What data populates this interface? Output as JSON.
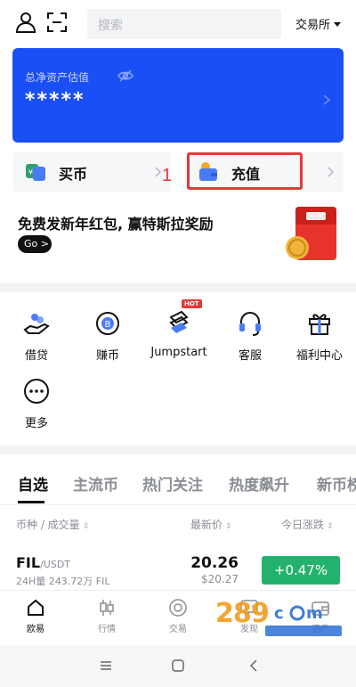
{
  "header": {
    "search_placeholder": "搜索",
    "exchange_label": "交易所"
  },
  "asset": {
    "label": "总净资产估值",
    "value": "*****"
  },
  "actions": {
    "buy_label": "买币",
    "deposit_label": "充值",
    "step_marker": "1"
  },
  "promo": {
    "text": "免费发新年红包, 赢特斯拉奖励",
    "button": "Go >"
  },
  "services": [
    {
      "label": "借贷",
      "icon": "loan-icon"
    },
    {
      "label": "赚币",
      "icon": "earn-coin-icon"
    },
    {
      "label": "Jumpstart",
      "icon": "jumpstart-icon",
      "badge": "HOT"
    },
    {
      "label": "客服",
      "icon": "headset-icon"
    },
    {
      "label": "福利中心",
      "icon": "gift-icon"
    },
    {
      "label": "更多",
      "icon": "more-dots-icon"
    }
  ],
  "market": {
    "tabs": [
      "自选",
      "主流币",
      "热门关注",
      "热度飙升",
      "新币榜"
    ],
    "active_tab": "自选",
    "columns": {
      "coin": "币种 / 成交量",
      "price": "最新价",
      "change": "今日涨跌"
    },
    "rows": [
      {
        "symbol": "FIL",
        "quote": "/USDT",
        "volume": "24H量 243.72万 FIL",
        "price": "20.26",
        "price_usd": "$20.27",
        "change": "+0.47%"
      }
    ]
  },
  "nav": [
    {
      "label": "欧易",
      "icon": "home-icon",
      "active": true
    },
    {
      "label": "行情",
      "icon": "candlestick-icon"
    },
    {
      "label": "交易",
      "icon": "trade-icon"
    },
    {
      "label": "发现",
      "icon": "chat-icon"
    },
    {
      "label": "资产",
      "icon": "wallet-icon"
    }
  ],
  "colors": {
    "brand_blue": "#1a4ff5",
    "up_green": "#23b26d",
    "annotation_red": "#e53935"
  }
}
